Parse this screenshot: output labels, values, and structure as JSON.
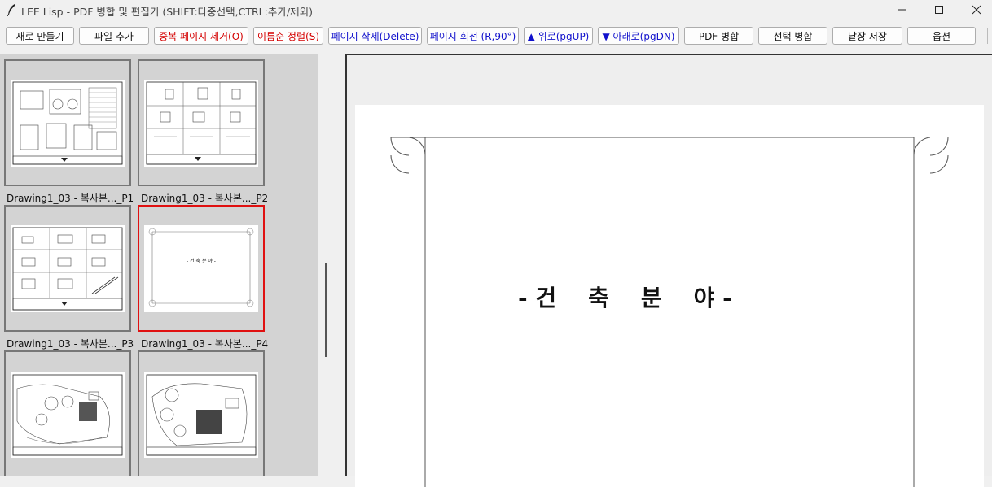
{
  "window": {
    "title": "LEE Lisp - PDF 병합 및 편집기 (SHIFT:다중선택,CTRL:추가/제외)",
    "controls": {
      "minimize": "—",
      "maximize": "☐",
      "close": "✕"
    }
  },
  "toolbar": {
    "buttons": [
      {
        "label": "새로 만들기",
        "color": "#111111"
      },
      {
        "label": "파일 추가",
        "color": "#111111"
      },
      {
        "label": "중복 페이지 제거(O)",
        "color": "#d40000"
      },
      {
        "label": "이름순 정렬(S)",
        "color": "#d40000"
      },
      {
        "label": "페이지 삭제(Delete)",
        "color": "#1010cc"
      },
      {
        "label": "페이지 회전 (R,90°)",
        "color": "#1010cc"
      },
      {
        "label": "▲ 위로(pgUP)",
        "color": "#1010cc"
      },
      {
        "label": "▼ 아래로(pgDN)",
        "color": "#1010cc"
      },
      {
        "label": "PDF 병합",
        "color": "#111111"
      },
      {
        "label": "선택 병합",
        "color": "#111111"
      },
      {
        "label": "낱장 저장",
        "color": "#111111"
      },
      {
        "label": "옵션",
        "color": "#111111"
      }
    ]
  },
  "thumbnails": [
    {
      "caption": "Drawing1_03 - 복사본..._P1",
      "kind": "plan",
      "selected": false
    },
    {
      "caption": "Drawing1_03 - 복사본..._P2",
      "kind": "details",
      "selected": false
    },
    {
      "caption": "Drawing1_03 - 복사본..._P3",
      "kind": "details",
      "selected": false
    },
    {
      "caption": "Drawing1_03 - 복사본..._P4",
      "kind": "cover",
      "selected": true
    },
    {
      "caption": "",
      "kind": "siteplan",
      "selected": false
    },
    {
      "caption": "",
      "kind": "siteplan",
      "selected": false
    }
  ],
  "thumb_cover_text": "- 건 축 분 야 -",
  "preview": {
    "title": "- 건    축    분    야 -"
  }
}
